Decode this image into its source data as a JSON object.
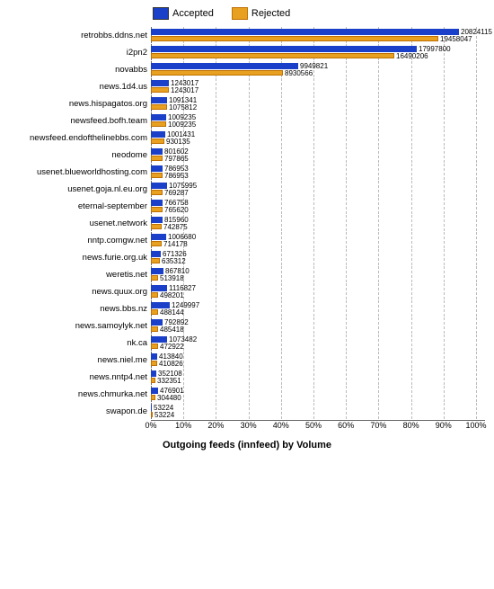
{
  "legend": {
    "accepted_label": "Accepted",
    "rejected_label": "Rejected",
    "accepted_color": "#1a3fc8",
    "rejected_color": "#e8a020"
  },
  "chart": {
    "title": "Outgoing feeds (innfeed) by Volume",
    "x_axis_labels": [
      "0%",
      "10%",
      "20%",
      "30%",
      "40%",
      "50%",
      "60%",
      "70%",
      "80%",
      "90%",
      "100%"
    ],
    "max_value": 22000000
  },
  "rows": [
    {
      "label": "retrobbs.ddns.net",
      "accepted": 20824115,
      "rejected": 19458047
    },
    {
      "label": "i2pn2",
      "accepted": 17997800,
      "rejected": 16490206
    },
    {
      "label": "novabbs",
      "accepted": 9949821,
      "rejected": 8930566
    },
    {
      "label": "news.1d4.us",
      "accepted": 1243017,
      "rejected": 1243017
    },
    {
      "label": "news.hispagatos.org",
      "accepted": 1091341,
      "rejected": 1075812
    },
    {
      "label": "newsfeed.bofh.team",
      "accepted": 1009235,
      "rejected": 1009235
    },
    {
      "label": "newsfeed.endofthelinebbs.com",
      "accepted": 1001431,
      "rejected": 930135
    },
    {
      "label": "neodome",
      "accepted": 801602,
      "rejected": 797865
    },
    {
      "label": "usenet.blueworldhosting.com",
      "accepted": 786953,
      "rejected": 786953
    },
    {
      "label": "usenet.goja.nl.eu.org",
      "accepted": 1075995,
      "rejected": 769287
    },
    {
      "label": "eternal-september",
      "accepted": 766758,
      "rejected": 765620
    },
    {
      "label": "usenet.network",
      "accepted": 815960,
      "rejected": 742875
    },
    {
      "label": "nntp.comgw.net",
      "accepted": 1006680,
      "rejected": 714178
    },
    {
      "label": "news.furie.org.uk",
      "accepted": 671326,
      "rejected": 635312
    },
    {
      "label": "weretis.net",
      "accepted": 867810,
      "rejected": 513918
    },
    {
      "label": "news.quux.org",
      "accepted": 1116827,
      "rejected": 498201
    },
    {
      "label": "news.bbs.nz",
      "accepted": 1249997,
      "rejected": 488144
    },
    {
      "label": "news.samoylyk.net",
      "accepted": 792892,
      "rejected": 485418
    },
    {
      "label": "nk.ca",
      "accepted": 1073482,
      "rejected": 472922
    },
    {
      "label": "news.niel.me",
      "accepted": 413840,
      "rejected": 410826
    },
    {
      "label": "news.nntp4.net",
      "accepted": 352108,
      "rejected": 332351
    },
    {
      "label": "news.chmurka.net",
      "accepted": 476901,
      "rejected": 304480
    },
    {
      "label": "swapon.de",
      "accepted": 53224,
      "rejected": 53224
    }
  ]
}
